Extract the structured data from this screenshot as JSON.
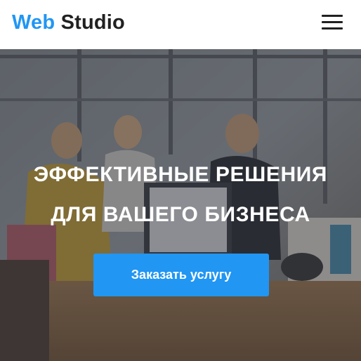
{
  "header": {
    "logo_accent": "Web",
    "logo_main": "Studio",
    "menu_icon": "hamburger-menu-icon"
  },
  "hero": {
    "title_line1": "ЭФФЕКТИВНЫЕ РЕШЕНИЯ",
    "title_line2": "ДЛЯ ВАШЕГО БИЗНЕСА",
    "cta_label": "Заказать услугу",
    "background": "office team meeting photo"
  },
  "colors": {
    "accent": "#2196f3",
    "text_dark": "#212121",
    "white": "#ffffff"
  }
}
